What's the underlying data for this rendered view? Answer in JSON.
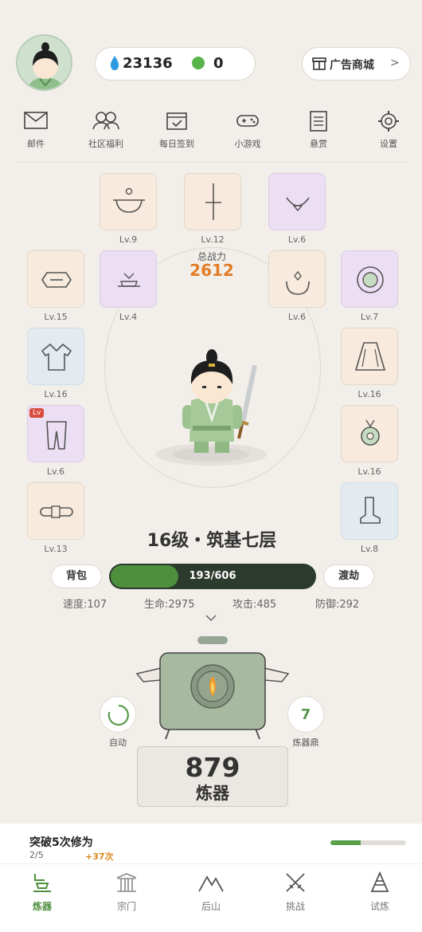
{
  "header": {
    "jade_amount": "23136",
    "green_amount": "0",
    "shop_label": "广告商城",
    "shop_arrow": ">"
  },
  "menu": [
    {
      "label": "邮件",
      "icon": "mail-icon"
    },
    {
      "label": "社区福利",
      "icon": "community-icon"
    },
    {
      "label": "每日签到",
      "icon": "checkin-icon"
    },
    {
      "label": "小游戏",
      "icon": "gamepad-icon"
    },
    {
      "label": "悬赏",
      "icon": "bounty-icon"
    },
    {
      "label": "设置",
      "icon": "settings-icon"
    }
  ],
  "equipment": {
    "hat": "Lv.9",
    "weapon": "Lv.12",
    "necklace": "Lv.6",
    "headband": "Lv.15",
    "incense": "Lv.4",
    "ring": "Lv.6",
    "jade_disc": "Lv.7",
    "robe": "Lv.16",
    "cloak": "Lv.16",
    "trousers": "Lv.6",
    "pendant": "Lv.16",
    "belt": "Lv.13",
    "boots": "Lv.8",
    "badge": "Lv"
  },
  "power": {
    "label": "总战力",
    "value": "2612"
  },
  "realm": "16级・筑基七层",
  "buttons": {
    "bag": "背包",
    "tribulation": "渡劫"
  },
  "experience": {
    "text": "193/606",
    "fraction": 0.318
  },
  "stats": {
    "speed": "速度:107",
    "hp": "生命:2975",
    "attack": "攻击:485",
    "defense": "防御:292"
  },
  "furnace": {
    "auto_label": "自动",
    "level": "7",
    "level_label": "炼器鼎",
    "refine_count": "879",
    "refine_label": "炼器"
  },
  "quest": {
    "title": "突破5次修为",
    "progress": "2/5",
    "reward": "+37次",
    "fraction": 0.4
  },
  "nav": [
    {
      "label": "炼器",
      "icon": "forge-icon",
      "active": true
    },
    {
      "label": "宗门",
      "icon": "sect-icon",
      "active": false
    },
    {
      "label": "后山",
      "icon": "mountain-icon",
      "active": false
    },
    {
      "label": "挑战",
      "icon": "swords-icon",
      "active": false
    },
    {
      "label": "试炼",
      "icon": "trial-icon",
      "active": false
    }
  ],
  "colors": {
    "background": "#f2efea",
    "accent_green": "#4e8f3e",
    "power_orange": "#e27c26",
    "exp_bar_dark": "#2d3a2e"
  }
}
